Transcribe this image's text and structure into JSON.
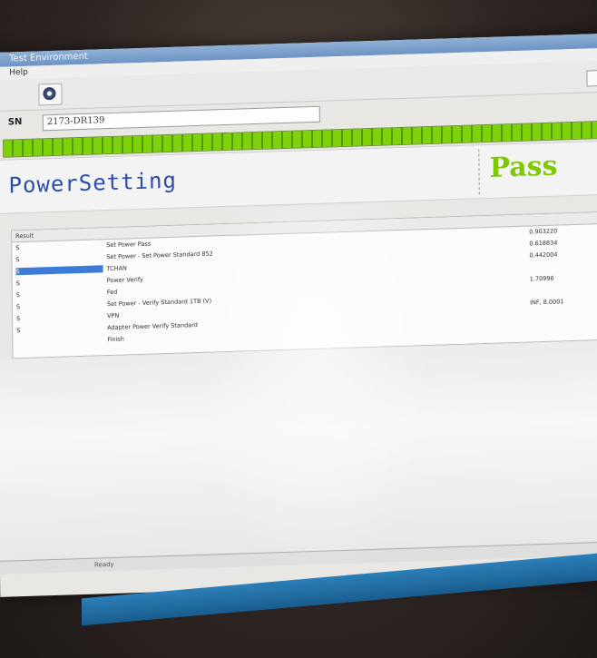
{
  "window": {
    "title": "Test Environment"
  },
  "menu": {
    "items": [
      "Help"
    ]
  },
  "serial": {
    "label": "SN",
    "value": "2173-DR139"
  },
  "progress": {
    "fraction": 1.0,
    "color": "#7fd20a"
  },
  "banner": {
    "test_name": "PowerSetting",
    "result": "Pass",
    "result_color": "#7ec800"
  },
  "grid": {
    "columns": [
      "Result"
    ],
    "rows": [
      {
        "id": "S",
        "name": "Set Power Pass",
        "value": "0.903220"
      },
      {
        "id": "S",
        "name": "Set Power - Set Power Standard 852",
        "value": "0.618834"
      },
      {
        "id": "S",
        "name": "TCHAN",
        "value": "0.442004"
      },
      {
        "id": "S",
        "name": "Power Verify",
        "value": ""
      },
      {
        "id": "S",
        "name": "Fed",
        "value": "1.70996"
      },
      {
        "id": "S",
        "name": "Set Power - Verify Standard 1TB (V)",
        "value": ""
      },
      {
        "id": "S",
        "name": "VPN",
        "value": "INF, 8.0001"
      },
      {
        "id": "S",
        "name": "Adapter Power Verify Standard",
        "value": ""
      },
      {
        "id": "",
        "name": "Finish",
        "value": ""
      }
    ]
  },
  "status": {
    "text": "Ready"
  }
}
